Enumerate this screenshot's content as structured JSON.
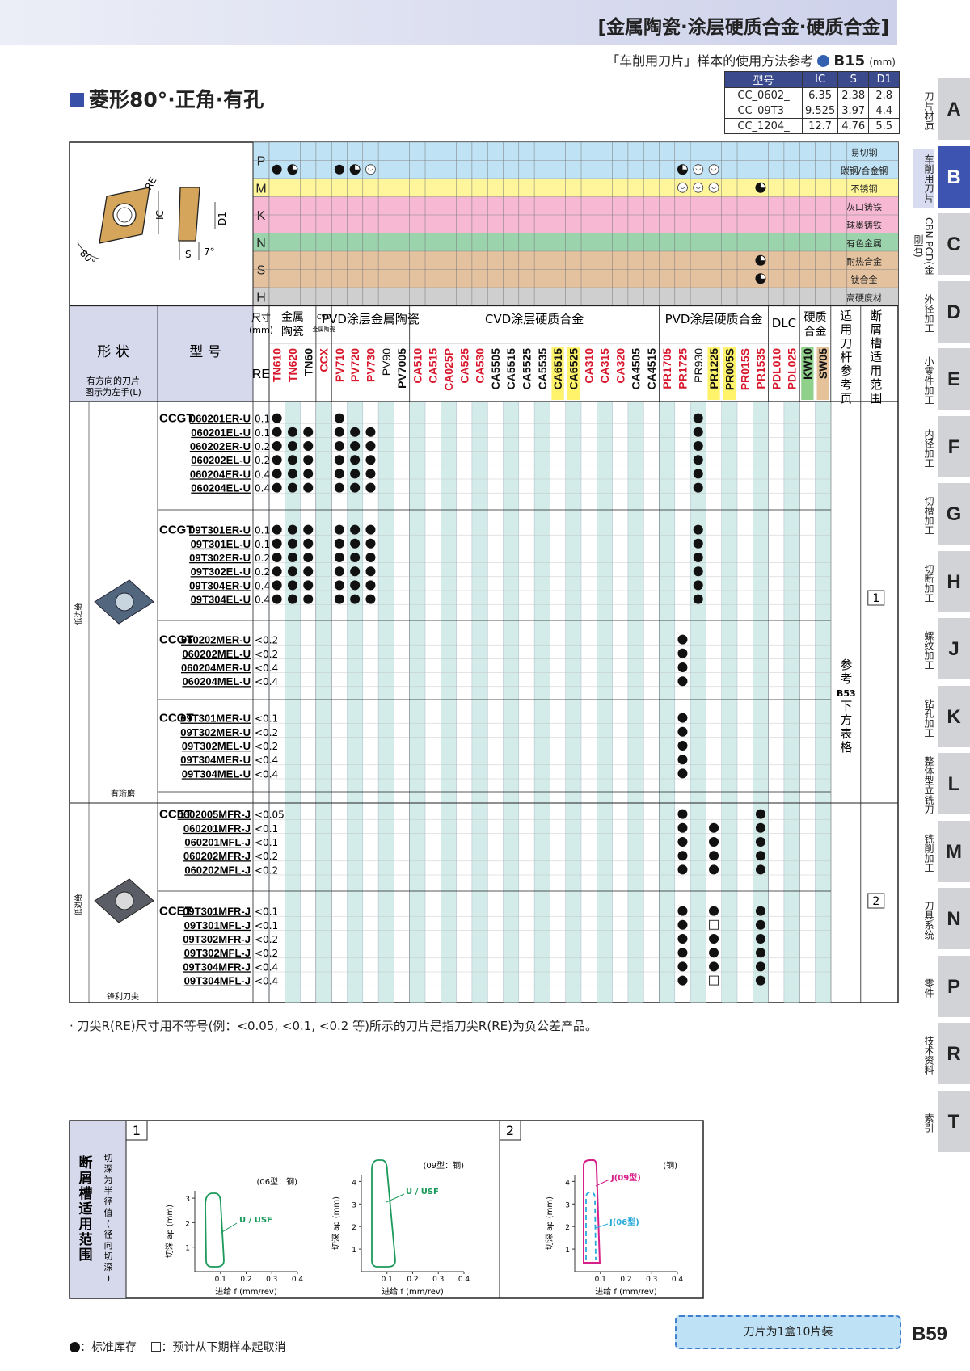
{
  "header": {
    "title": "[金属陶瓷·涂层硬质合金·硬质合金]",
    "ref_text": "「车削用刀片」样本的使用方法参考",
    "ref_page": "B15",
    "unit": "(mm)"
  },
  "dims": {
    "headers": [
      "型号",
      "IC",
      "S",
      "D1"
    ],
    "rows": [
      [
        "CC_0602_",
        "6.35",
        "2.38",
        "2.8"
      ],
      [
        "CC_09T3_",
        "9.525",
        "3.97",
        "4.4"
      ],
      [
        "CC_1204_",
        "12.7",
        "4.76",
        "5.5"
      ]
    ]
  },
  "page_title": "菱形80°·正角·有孔",
  "figure": {
    "RE": "RE",
    "IC": "IC",
    "D1": "D1",
    "S": "S",
    "angle": "7°",
    "corner": "80°"
  },
  "materials": [
    {
      "code": "P",
      "rows": [
        "易切钢",
        "碳钢/合金钢"
      ],
      "color": "#bfe3f5"
    },
    {
      "code": "M",
      "rows": [
        "不锈钢"
      ],
      "color": "#fff59a"
    },
    {
      "code": "K",
      "rows": [
        "灰口铸铁",
        "球墨铸铁"
      ],
      "color": "#f6b8d2"
    },
    {
      "code": "N",
      "rows": [
        "有色金属"
      ],
      "color": "#9bd3ad"
    },
    {
      "code": "S",
      "rows": [
        "耐热合金",
        "钛合金"
      ],
      "color": "#e5c29f"
    },
    {
      "code": "H",
      "rows": [
        "高硬度材"
      ],
      "color": "#cfcfcf"
    }
  ],
  "group_headers": [
    "尺寸(mm)",
    "金属陶瓷",
    "CVD/金属陶瓷",
    "PVD涂层金属陶瓷",
    "CVD涂层硬质合金",
    "PVD涂层硬质合金",
    "DLC",
    "硬质合金",
    "适用刀杆参考页",
    "断屑槽适用范围"
  ],
  "left_headers": {
    "shape": "形 状",
    "shape_note": "有方向的刀片\n图示为左手(L)",
    "model": "型 号",
    "re": "RE"
  },
  "grades": [
    "TN610",
    "TN620",
    "TN60",
    "CCX",
    "PV710",
    "PV720",
    "PV730",
    "PV90",
    "PV7005",
    "CA510",
    "CA515",
    "CA025P",
    "CA525",
    "CA530",
    "CA5505",
    "CA5515",
    "CA5525",
    "CA5535",
    "CA6515",
    "CA6525",
    "CA310",
    "CA315",
    "CA320",
    "CA4505",
    "CA4515",
    "PR1705",
    "PR1725",
    "PR930",
    "PR1225",
    "PR005S",
    "PR015S",
    "PR1535",
    "PDL010",
    "PDL025",
    "KW10",
    "SW05"
  ],
  "material_marks": {
    "P1": [],
    "P2": [
      [
        0,
        "F"
      ],
      [
        1,
        "H"
      ],
      [
        4,
        "F"
      ],
      [
        5,
        "H"
      ],
      [
        6,
        "O"
      ],
      [
        26,
        "H"
      ],
      [
        27,
        "O"
      ],
      [
        28,
        "O"
      ]
    ],
    "M": [
      [
        26,
        "O"
      ],
      [
        27,
        "O"
      ],
      [
        28,
        "O"
      ],
      [
        31,
        "H"
      ]
    ],
    "K1": [],
    "K2": [],
    "N": [],
    "S1": [
      [
        31,
        "H"
      ]
    ],
    "S2": [
      [
        31,
        "H"
      ]
    ],
    "H": []
  },
  "shape_labels": {
    "low1": "低进给",
    "low2": "低进给",
    "ground": "有珩磨",
    "sharp": "锋利刀尖"
  },
  "series": [
    {
      "prefix": "CCGT",
      "items": [
        [
          "060201ER-U",
          "0.1",
          [
            0,
            4,
            27
          ]
        ],
        [
          "060201EL-U",
          "0.1",
          [
            0,
            1,
            2,
            4,
            5,
            6,
            27
          ]
        ],
        [
          "060202ER-U",
          "0.2",
          [
            0,
            1,
            2,
            4,
            5,
            6,
            27
          ]
        ],
        [
          "060202EL-U",
          "0.2",
          [
            0,
            1,
            2,
            4,
            5,
            6,
            27
          ]
        ],
        [
          "060204ER-U",
          "0.4",
          [
            0,
            1,
            2,
            4,
            5,
            6,
            27
          ]
        ],
        [
          "060204EL-U",
          "0.4",
          [
            0,
            1,
            2,
            4,
            5,
            6,
            27
          ]
        ]
      ]
    },
    {
      "prefix": "CCGT",
      "items": [
        [
          "09T301ER-U",
          "0.1",
          [
            0,
            1,
            2,
            4,
            5,
            6,
            27
          ]
        ],
        [
          "09T301EL-U",
          "0.1",
          [
            0,
            1,
            2,
            4,
            5,
            6,
            27
          ]
        ],
        [
          "09T302ER-U",
          "0.2",
          [
            0,
            1,
            2,
            4,
            5,
            6,
            27
          ]
        ],
        [
          "09T302EL-U",
          "0.2",
          [
            0,
            1,
            2,
            4,
            5,
            6,
            27
          ]
        ],
        [
          "09T304ER-U",
          "0.4",
          [
            0,
            1,
            2,
            4,
            5,
            6,
            27
          ]
        ],
        [
          "09T304EL-U",
          "0.4",
          [
            0,
            1,
            2,
            4,
            5,
            6,
            27
          ]
        ]
      ]
    },
    {
      "prefix": "CCGT",
      "items": [
        [
          "060202MER-U",
          "<0.2",
          [
            26
          ]
        ],
        [
          "060202MEL-U",
          "<0.2",
          [
            26
          ]
        ],
        [
          "060204MER-U",
          "<0.4",
          [
            26
          ]
        ],
        [
          "060204MEL-U",
          "<0.4",
          [
            26
          ]
        ]
      ]
    },
    {
      "prefix": "CCGT",
      "items": [
        [
          "09T301MER-U",
          "<0.1",
          [
            26
          ]
        ],
        [
          "09T302MER-U",
          "<0.2",
          [
            26
          ]
        ],
        [
          "09T302MEL-U",
          "<0.2",
          [
            26
          ]
        ],
        [
          "09T304MER-U",
          "<0.4",
          [
            26
          ]
        ],
        [
          "09T304MEL-U",
          "<0.4",
          [
            26
          ]
        ]
      ]
    },
    {
      "prefix": "CCET",
      "items": [
        [
          "0602005MFR-J",
          "<0.05",
          [
            26,
            31
          ]
        ],
        [
          "060201MFR-J",
          "<0.1",
          [
            26,
            28,
            31
          ]
        ],
        [
          "060201MFL-J",
          "<0.1",
          [
            26,
            28,
            31
          ]
        ],
        [
          "060202MFR-J",
          "<0.2",
          [
            26,
            28,
            31
          ]
        ],
        [
          "060202MFL-J",
          "<0.2",
          [
            26,
            28,
            31
          ]
        ]
      ]
    },
    {
      "prefix": "CCET",
      "items": [
        [
          "09T301MFR-J",
          "<0.1",
          [
            26,
            28,
            31
          ]
        ],
        [
          "09T301MFL-J",
          "<0.1",
          [
            26,
            31
          ],
          [
            28
          ]
        ],
        [
          "09T302MFR-J",
          "<0.2",
          [
            26,
            28,
            31
          ]
        ],
        [
          "09T302MFL-J",
          "<0.2",
          [
            26,
            28,
            31
          ]
        ],
        [
          "09T304MFR-J",
          "<0.4",
          [
            26,
            28,
            31
          ]
        ],
        [
          "09T304MFL-J",
          "<0.4",
          [
            26,
            31
          ],
          [
            28
          ]
        ]
      ]
    }
  ],
  "holder_ref": "参考B53下方表格",
  "chip_ranges": [
    "1",
    "2"
  ],
  "note": "· 刀尖R(RE)尺寸用不等号(例：<0.05, <0.1, <0.2 等)所示的刀片是指刀尖R(RE)为负公差产品。",
  "chip_box": {
    "title": "断屑槽适用范围",
    "subtitle": "切深为半径值(径向切深)",
    "panels": [
      {
        "num": "1",
        "charts": [
          {
            "label": "(06型：钢)",
            "curve": "U / USF",
            "ylabel": "切深 ap (mm)",
            "xlabel": "进给 f (mm/rev)",
            "yticks": [
              "1",
              "2",
              "3"
            ],
            "xticks": [
              "0.1",
              "0.2",
              "0.3",
              "0.4"
            ]
          },
          {
            "label": "(09型：钢)",
            "curve": "U / USF",
            "ylabel": "切深 ap (mm)",
            "xlabel": "进给 f (mm/rev)",
            "yticks": [
              "1",
              "2",
              "3",
              "4"
            ],
            "xticks": [
              "0.1",
              "0.2",
              "0.3",
              "0.4"
            ]
          }
        ]
      },
      {
        "num": "2",
        "charts": [
          {
            "label": "(钢)",
            "curve1": "J(09型)",
            "curve2": "J(06型)",
            "ylabel": "切深 ap (mm)",
            "xlabel": "进给 f (mm/rev)",
            "yticks": [
              "1",
              "2",
              "3",
              "4"
            ],
            "xticks": [
              "0.1",
              "0.2",
              "0.3",
              "0.4"
            ]
          }
        ]
      }
    ]
  },
  "box_note": "刀片为1盒10片装",
  "page_no": "B59",
  "legend": {
    "std": "：标准库存",
    "cancel": "：预计从下期样本起取消"
  },
  "sidebar": [
    {
      "letter": "A",
      "label": "刀片材质"
    },
    {
      "letter": "B",
      "label": "车削用刀片",
      "active": true
    },
    {
      "letter": "C",
      "label": "CBN PCD(金刚石)"
    },
    {
      "letter": "D",
      "label": "外径加工"
    },
    {
      "letter": "E",
      "label": "小零件加工"
    },
    {
      "letter": "F",
      "label": "内径加工"
    },
    {
      "letter": "G",
      "label": "切槽加工"
    },
    {
      "letter": "H",
      "label": "切断加工"
    },
    {
      "letter": "J",
      "label": "螺纹加工"
    },
    {
      "letter": "K",
      "label": "钻孔加工"
    },
    {
      "letter": "L",
      "label": "整体型立铣刀"
    },
    {
      "letter": "M",
      "label": "铣削加工"
    },
    {
      "letter": "N",
      "label": "刀具系统"
    },
    {
      "letter": "P",
      "label": "零件"
    },
    {
      "letter": "R",
      "label": "技术资料"
    },
    {
      "letter": "T",
      "label": "索引"
    }
  ]
}
